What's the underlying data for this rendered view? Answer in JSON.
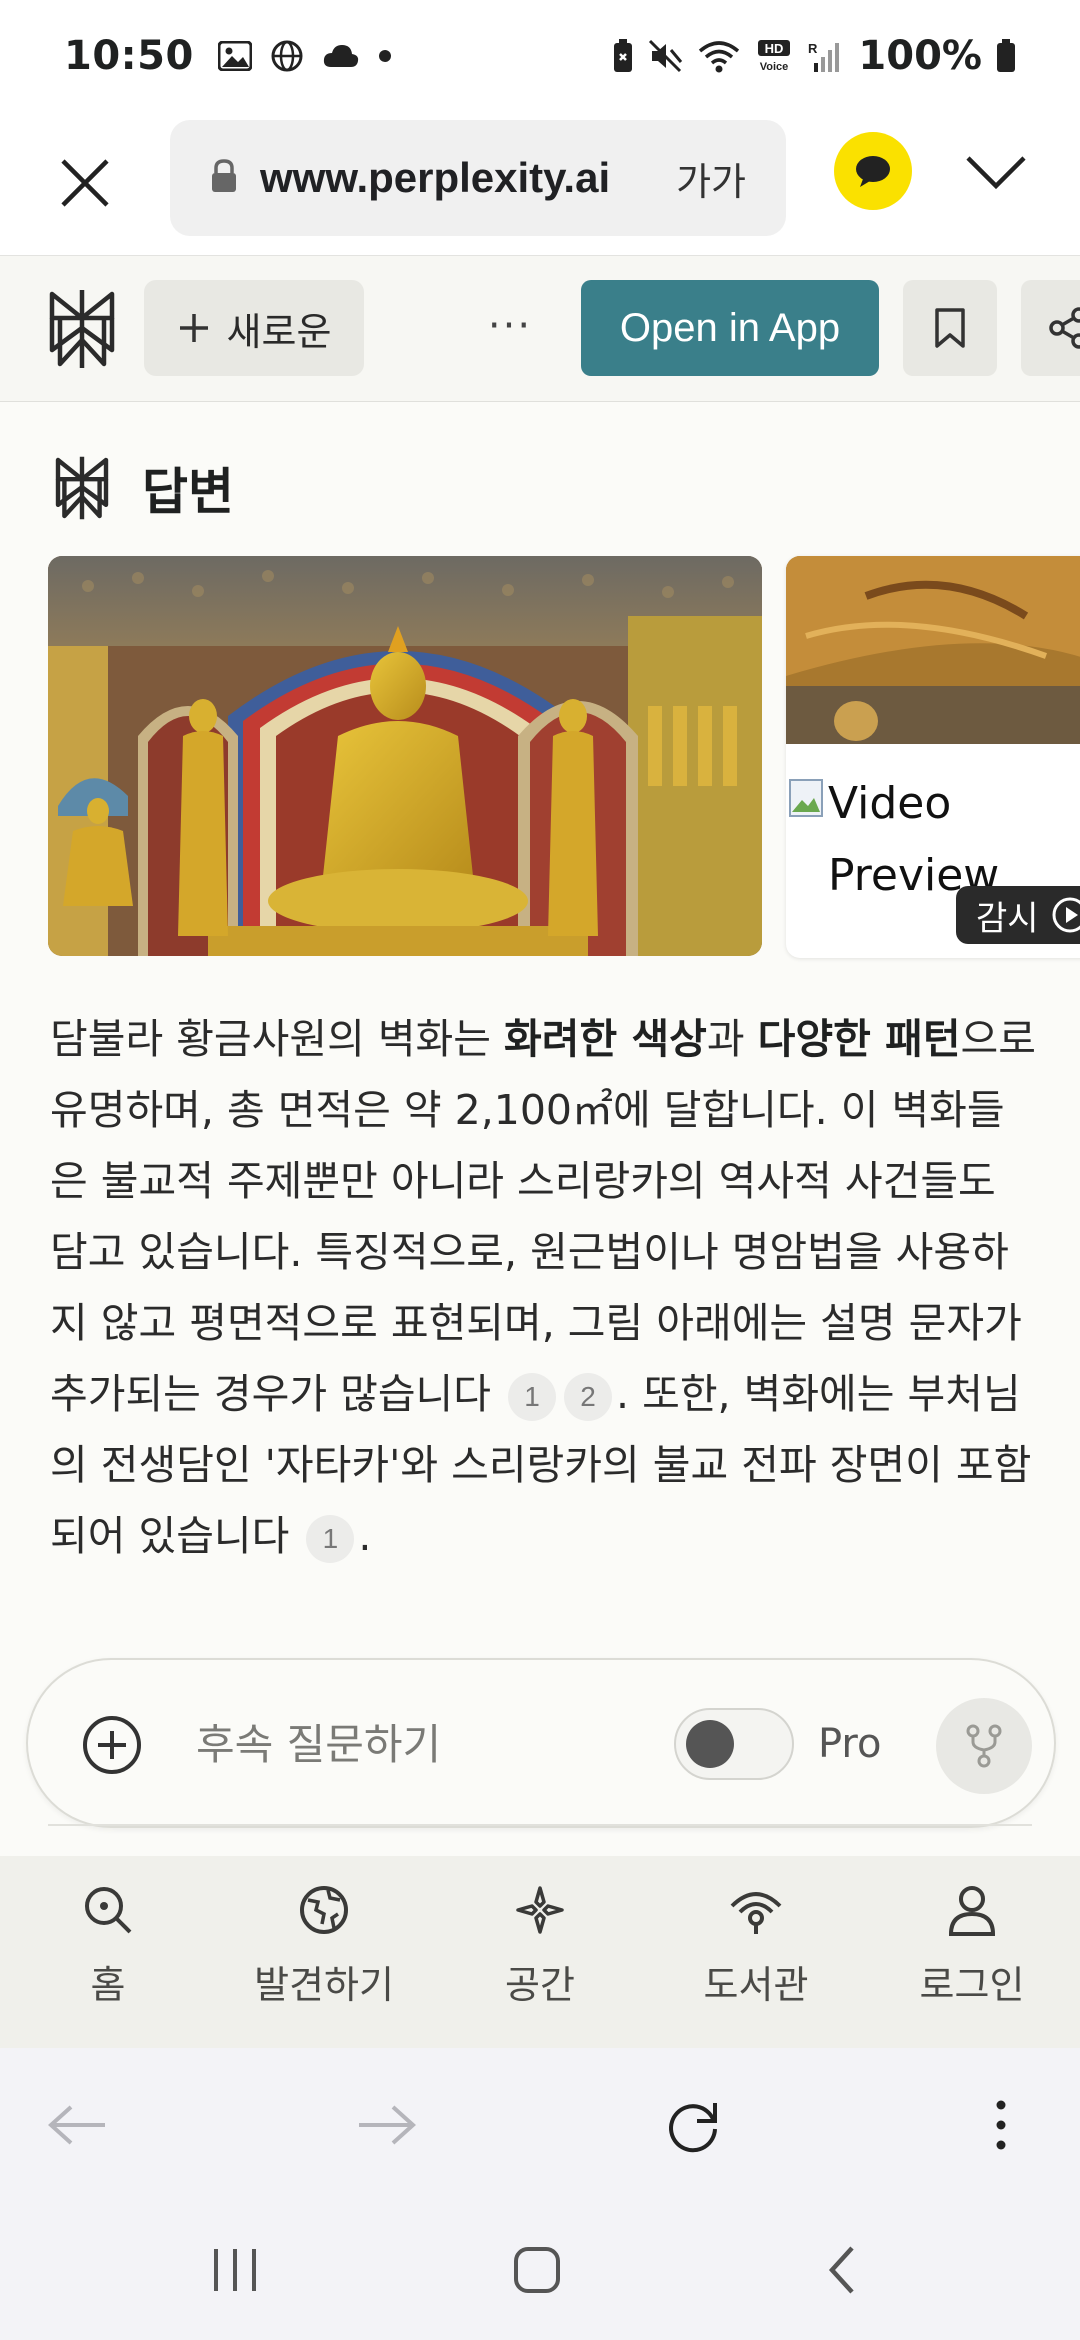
{
  "status_bar": {
    "time": "10:50",
    "battery": "100%",
    "left_icons": [
      "gallery-icon",
      "globe-icon",
      "cloud-icon",
      "dot-icon"
    ],
    "right_icons": [
      "lock-battery-icon",
      "mute-icon",
      "wifi-icon",
      "hd-voice-icon",
      "signal-icon",
      "battery-icon"
    ]
  },
  "browser": {
    "url": "www.perplexity.ai",
    "text_size_label": "가가"
  },
  "app_header": {
    "new_label": "새로운",
    "more_label": "···",
    "open_app_label": "Open in App"
  },
  "answer": {
    "heading": "답변",
    "video_alt": "Video Preview",
    "watch_label": "감시",
    "paragraph": {
      "p1": "담불라 황금사원의 벽화는 ",
      "b1": "화려한 색상",
      "p2": "과 ",
      "b2": "다양한 패턴",
      "p3": "으로 유명하며, 총 면적은 약 2,100㎡에 달합니다. 이 벽화들은 불교적 주제뿐만 아니라 스리랑카의 역사적 사건들도 담고 있습니다. 특징적으로, 원근법이나 명암법을 사용하지 않고 평면적으로 표현되며, 그림 아래에는 설명 문자가 추가되는 경우가 많습니다 ",
      "c1": "1",
      "c2": "2",
      "p4": ". 또한, 벽화에는 부처님의 전생담인 '자타카'와 스리랑카의 불교 전파 장면이 포함되어 있습니다 ",
      "c3": "1",
      "p5": "."
    }
  },
  "followup": {
    "placeholder": "후속 질문하기",
    "pro_label": "Pro"
  },
  "app_nav": {
    "items": [
      {
        "label": "홈",
        "icon": "home-search-icon"
      },
      {
        "label": "발견하기",
        "icon": "discover-globe-icon"
      },
      {
        "label": "공간",
        "icon": "spaces-sparkle-icon"
      },
      {
        "label": "도서관",
        "icon": "library-icon"
      },
      {
        "label": "로그인",
        "icon": "user-icon"
      }
    ]
  },
  "colors": {
    "accent": "#3a7f8a",
    "kakao": "#fae100",
    "background": "#fbfbf8"
  }
}
